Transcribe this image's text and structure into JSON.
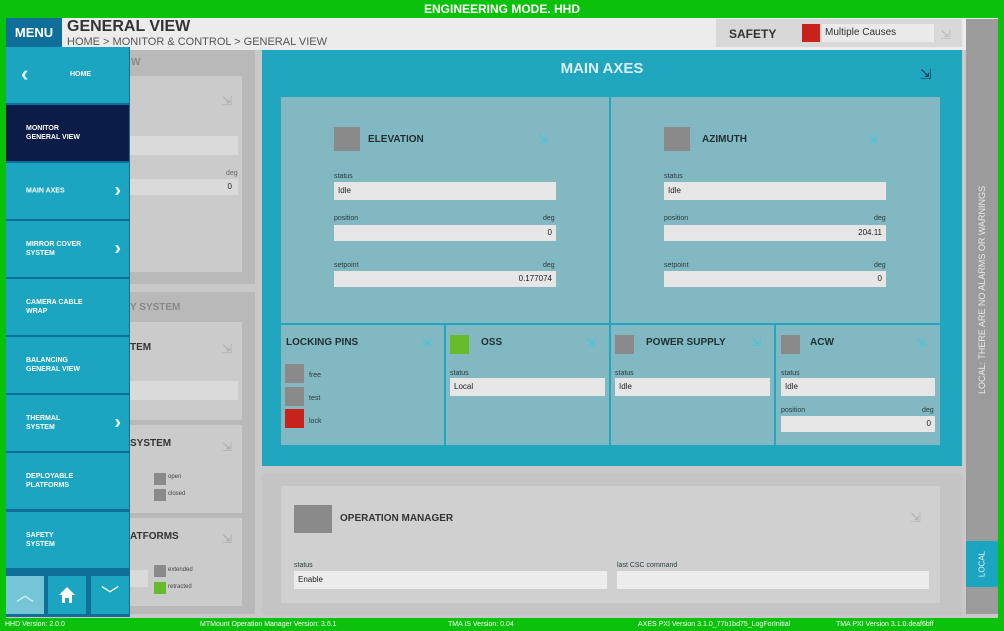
{
  "banner": "ENGINEERING MODE. HHD",
  "menu_label": "MENU",
  "page_title": "GENERAL VIEW",
  "breadcrumb": "HOME > MONITOR & CONTROL > GENERAL VIEW",
  "safety": {
    "label": "SAFETY",
    "value": "Multiple Causes",
    "color": "#c8221c"
  },
  "alarms_text": "LOCAL: THERE ARE NO ALARMS OR WARNINGS",
  "local_label": "LOCAL",
  "drawer": {
    "home_label": "HOME",
    "items": [
      {
        "label": "MONITOR GENERAL VIEW",
        "line1": "MONITOR",
        "line2": "GENERAL VIEW",
        "chevron": false
      },
      {
        "label": "MAIN AXES",
        "line1": "MAIN AXES",
        "line2": "",
        "chevron": true
      },
      {
        "label": "MIRROR COVER SYSTEM",
        "line1": "MIRROR COVER",
        "line2": "SYSTEM",
        "chevron": true
      },
      {
        "label": "CAMERA CABLE WRAP",
        "line1": "CAMERA CABLE",
        "line2": "WRAP",
        "chevron": false
      },
      {
        "label": "BALANCING GENERAL VIEW",
        "line1": "BALANCING",
        "line2": "GENERAL VIEW",
        "chevron": false
      },
      {
        "label": "THERMAL SYSTEM",
        "line1": "THERMAL",
        "line2": "SYSTEM",
        "chevron": true
      },
      {
        "label": "DEPLOYABLE PLATFORMS",
        "line1": "DEPLOYABLE",
        "line2": "PLATFORMS",
        "chevron": false
      },
      {
        "label": "SAFETY SYSTEM",
        "line1": "SAFETY",
        "line2": "SYSTEM",
        "chevron": false
      }
    ]
  },
  "bg": {
    "partial1": "W",
    "val1": "0",
    "unit1": "deg",
    "partial2": "Y SYSTEM",
    "partial3": "TEM",
    "partial4": "SYSTEM",
    "open": "open",
    "closed": "closed",
    "partial5": "ATFORMS",
    "extended": "extended",
    "retracted": "retracted"
  },
  "main_axes": {
    "title": "MAIN AXES",
    "elevation": {
      "label": "ELEVATION",
      "status_label": "status",
      "status": "Idle",
      "position_label": "position",
      "position": "0",
      "unit": "deg",
      "setpoint_label": "setpoint",
      "setpoint": "0.177074"
    },
    "azimuth": {
      "label": "AZIMUTH",
      "status_label": "status",
      "status": "Idle",
      "position_label": "position",
      "position": "204.11",
      "unit": "deg",
      "setpoint_label": "setpoint",
      "setpoint": "0"
    },
    "locking_pins": {
      "label": "LOCKING PINS",
      "free": "free",
      "test": "test",
      "lock": "lock",
      "lock_color": "#c8221c"
    },
    "oss": {
      "label": "OSS",
      "status_label": "status",
      "status": "Local",
      "color": "#66bb2a"
    },
    "power_supply": {
      "label": "POWER SUPPLY",
      "status_label": "status",
      "status": "Idle"
    },
    "acw": {
      "label": "ACW",
      "status_label": "status",
      "status": "Idle",
      "position_label": "position",
      "position": "0",
      "unit": "deg"
    }
  },
  "operation_manager": {
    "label": "OPERATION MANAGER",
    "status_label": "status",
    "status": "Enable",
    "last_cmd_label": "last CSC command",
    "last_cmd": ""
  },
  "footer": {
    "hhd": "HHD Version:  2.0.0",
    "mtmount": "MTMount Operation Manager Version:  3.6.1",
    "tma_is": "TMA IS Version:  0.04",
    "axes": "AXES PXI Version  3.1.0_77b1bd75_LogForInitial",
    "tma_pxi": "TMA PXI Version  3.1.0.deaf6bff"
  }
}
